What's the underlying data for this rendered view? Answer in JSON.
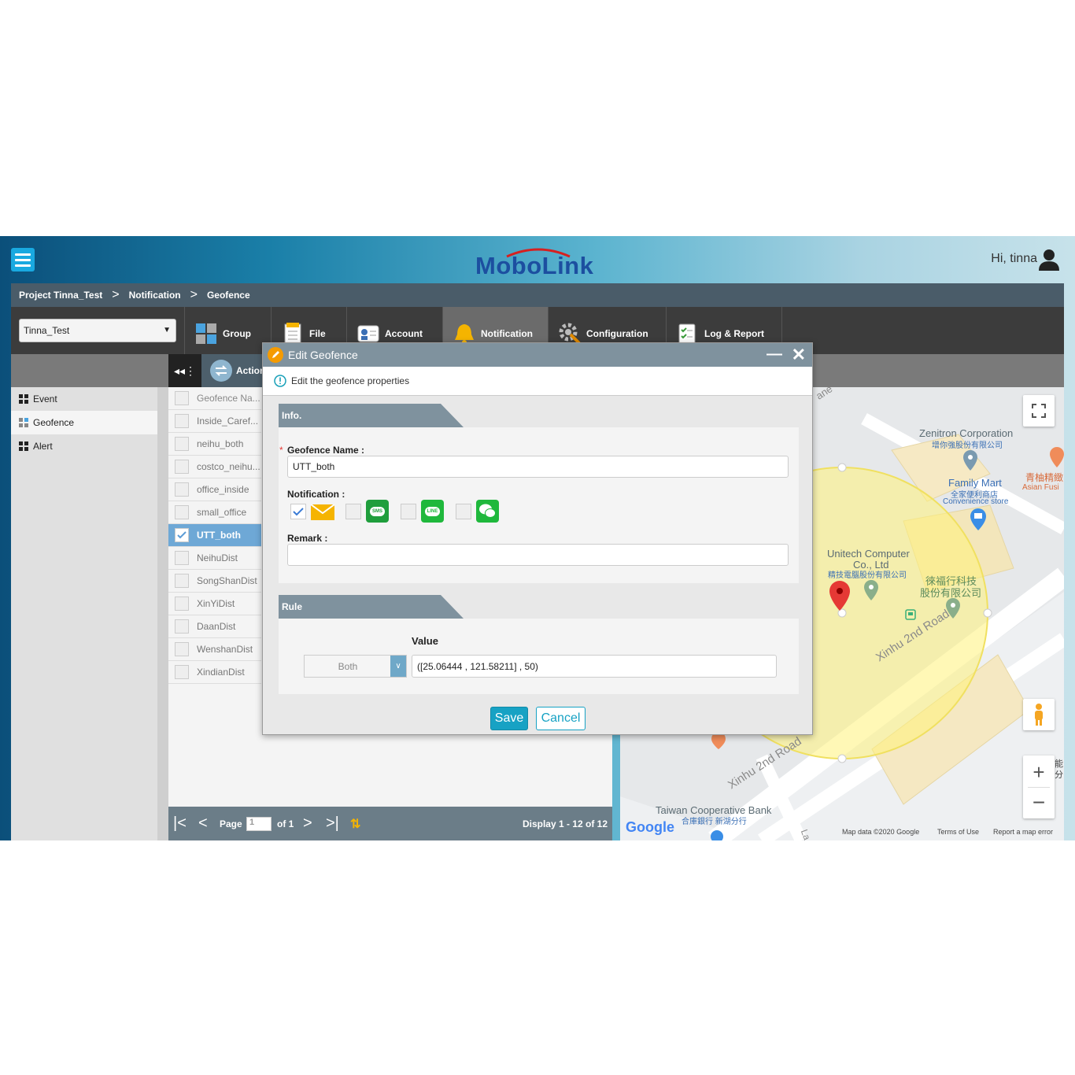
{
  "header": {
    "logo_text": "MoboLink",
    "greeting": "Hi, tinna"
  },
  "breadcrumb": [
    "Project Tinna_Test",
    "Notification",
    "Geofence"
  ],
  "project_select": {
    "value": "Tinna_Test"
  },
  "tabs": [
    {
      "label": "Group",
      "icon": "puzzle-icon"
    },
    {
      "label": "File",
      "icon": "file-icon"
    },
    {
      "label": "Account",
      "icon": "account-card-icon"
    },
    {
      "label": "Notification",
      "icon": "bell-icon",
      "active": true
    },
    {
      "label": "Configuration",
      "icon": "gear-wrench-icon"
    },
    {
      "label": "Log & Report",
      "icon": "report-icon"
    }
  ],
  "subbar": {
    "action_label": "Action"
  },
  "sidebar": {
    "items": [
      {
        "label": "Event"
      },
      {
        "label": "Geofence",
        "active": true
      },
      {
        "label": "Alert"
      }
    ]
  },
  "grid": {
    "header": "Geofence Na...",
    "rows": [
      "Inside_Caref...",
      "neihu_both",
      "costco_neihu...",
      "office_inside",
      "small_office",
      "UTT_both",
      "NeihuDist",
      "SongShanDist",
      "XinYiDist",
      "DaanDist",
      "WenshanDist",
      "XindianDist"
    ],
    "selected": "UTT_both"
  },
  "pager": {
    "page_label": "Page",
    "page_value": "1",
    "of_label": "of 1",
    "display": "Display 1 - 12 of 12"
  },
  "modal": {
    "title": "Edit Geofence",
    "info_text": "Edit the geofence properties",
    "info_section": "Info.",
    "name_label": "Geofence Name :",
    "required_mark": "*",
    "name_value": "UTT_both",
    "notification_label": "Notification :",
    "notifications": [
      {
        "icon": "email-icon",
        "checked": true
      },
      {
        "icon": "sms-icon",
        "checked": false,
        "text": "SMS"
      },
      {
        "icon": "line-icon",
        "checked": false,
        "text": "LINE"
      },
      {
        "icon": "wechat-icon",
        "checked": false
      }
    ],
    "remark_label": "Remark :",
    "remark_value": "",
    "rule_section": "Rule",
    "value_label": "Value",
    "rule_select": "Both",
    "rule_value": "([25.06444 , 121.58211] , 50)",
    "save_label": "Save",
    "cancel_label": "Cancel"
  },
  "map": {
    "labels": {
      "zenitron": "Zenitron Corporation",
      "zenitron_zh": "增你強股份有限公司",
      "family_mart": "Family Mart",
      "family_mart_zh": "全家便利商店",
      "convenience": "Convenience store",
      "qingyou": "青柚精緻",
      "asian": "Asian Fusi",
      "unitech": "Unitech Computer",
      "unitech2": "Co., Ltd",
      "unitech_zh": "精技電腦股份有限公司",
      "laifu1": "徠福行科技",
      "laifu2": "股份有限公司",
      "road1": "Xinhu 2nd Road",
      "road2": "Xinhu 2nd Road",
      "bank": "Taiwan Cooperative Bank",
      "bank_zh": "合庫銀行 新湖分行",
      "google": "Google",
      "attribution": "Map data ©2020 Google",
      "terms": "Terms of Use",
      "report": "Report a map error",
      "lane": "ane",
      "la": "La",
      "side_zh1": "能",
      "side_zh2": "分"
    },
    "circle_color": "#fff27a"
  },
  "colors": {
    "accent_blue": "#19a9e0",
    "save_btn": "#17a2c4",
    "selected_row": "#6ea8d6",
    "modal_header": "#7f929e"
  }
}
